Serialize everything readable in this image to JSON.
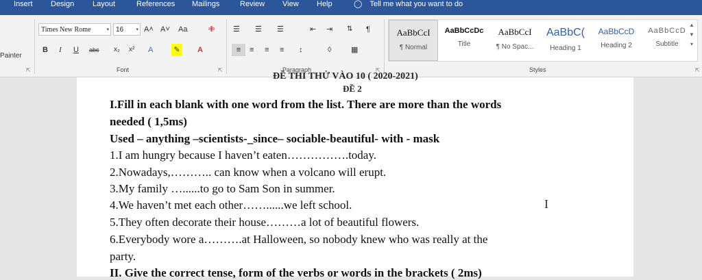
{
  "menu": [
    "Insert",
    "Design",
    "Layout",
    "References",
    "Mailings",
    "Review",
    "View",
    "Help"
  ],
  "tell_me": "Tell me what you want to do",
  "clipboard": {
    "painter": "Painter"
  },
  "font": {
    "name": "Times New Rome",
    "size": "16",
    "grow": "A˄",
    "shrink": "A˅",
    "case": "Aa",
    "bold": "B",
    "italic": "I",
    "underline": "U",
    "strike": "abc",
    "subscript": "x₂",
    "superscript": "x²",
    "group_label": "Font"
  },
  "paragraph": {
    "group_label": "Paragraph"
  },
  "styles": {
    "group_label": "Styles",
    "items": [
      {
        "preview": "AaBbCcI",
        "name": "¶ Normal"
      },
      {
        "preview": "AaBbCcDc",
        "name": "Title"
      },
      {
        "preview": "AaBbCcI",
        "name": "¶ No Spac..."
      },
      {
        "preview": "AaBbC(",
        "name": "Heading 1"
      },
      {
        "preview": "AaBbCcD",
        "name": "Heading 2"
      },
      {
        "preview": "AaBbCcD",
        "name": "Subtitle"
      }
    ]
  },
  "doc": {
    "top_partial": "ĐỀ THI THỬ VÀO 10 ( 2020-2021)",
    "de2": "ĐỀ 2",
    "heading1": "I.Fill in each blank with one word from the list. There are more than the words",
    "heading1b": "needed ( 1,5ms)",
    "wordlist": "Used – anything –scientists-_since– sociable-beautiful- with - mask",
    "q1": "1.I am hungry because I haven’t eaten…………….today.",
    "q2": "2.Nowadays,……….. can know when a volcano will erupt.",
    "q3": "3.My family …......to go to Sam Son in summer.",
    "q4": "4.We haven’t met each other……......we left school.",
    "q5": "5.They often decorate their house………a lot of beautiful flowers.",
    "q6": "6.Everybody wore a……….at Halloween, so nobody knew who was really at the",
    "q6b": "party.",
    "heading2": "II. Give the correct tense, form of the verbs or words in the brackets ( 2ms)"
  },
  "colors": {
    "accent": "#2b579a",
    "ribbon_bg": "#f3f3f3",
    "highlight": "#ffff00",
    "font_color": "#e03030"
  }
}
